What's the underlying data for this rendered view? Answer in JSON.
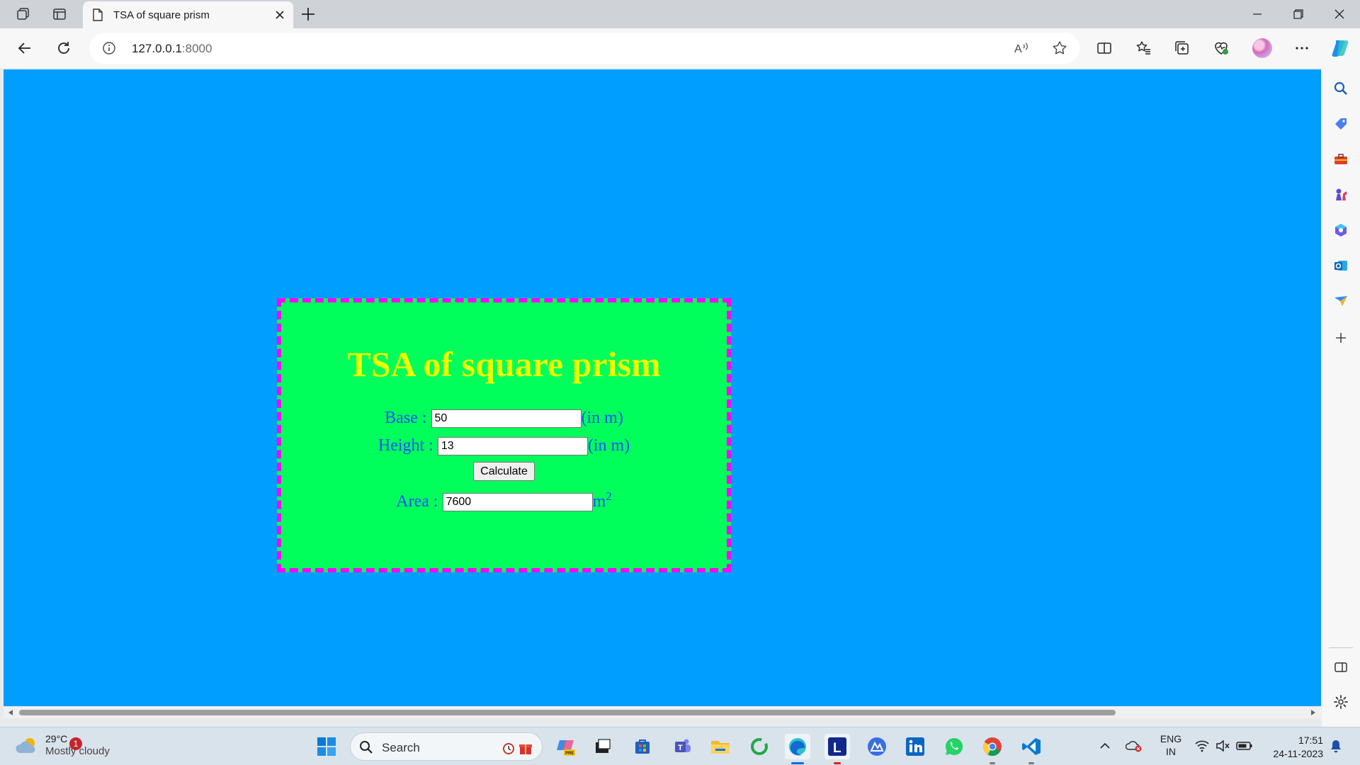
{
  "browser": {
    "tab_title": "TSA of square prism",
    "url_host": "127.0.0.1",
    "url_port": ":8000"
  },
  "page": {
    "heading": "TSA of square prism",
    "base_label": "Base : ",
    "base_value": "50",
    "base_unit": "(in m)",
    "height_label": "Height : ",
    "height_value": "13",
    "height_unit": "(in m)",
    "calculate_label": "Calculate",
    "area_label": "Area : ",
    "area_value": "7600",
    "area_unit": "m",
    "area_unit_exp": "2",
    "colors": {
      "page_background": "#009eff",
      "card_background": "#00ff5a",
      "card_border": "#ff00ff",
      "heading": "#eaff00",
      "label": "#1a4dff"
    }
  },
  "taskbar": {
    "weather_temp": "29°C",
    "weather_desc": "Mostly cloudy",
    "weather_badge": "1",
    "search_label": "Search",
    "lang_top": "ENG",
    "lang_bottom": "IN",
    "time": "17:51",
    "date": "24-11-2023"
  }
}
